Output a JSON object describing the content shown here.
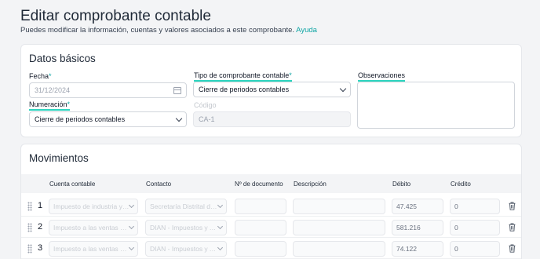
{
  "header": {
    "title": "Editar comprobante contable",
    "subtitle": "Puedes modificar la información, cuentas y valores asociados a este comprobante.",
    "help_link": "Ayuda"
  },
  "basic": {
    "section_title": "Datos básicos",
    "fecha_label": "Fecha",
    "fecha_value": "31/12/2024",
    "tipo_label": "Tipo de comprobante contable",
    "tipo_value": "Cierre de periodos contables",
    "obs_label": "Observaciones",
    "obs_value": "",
    "numeracion_label": "Numeración",
    "numeracion_value": "Cierre de periodos contables",
    "codigo_label": "Código",
    "codigo_value": "CA-1",
    "required_mark": "*"
  },
  "movements": {
    "section_title": "Movimientos",
    "columns": [
      "Cuenta contable",
      "Contacto",
      "Nº de documento",
      "Descripción",
      "Débito",
      "Crédito"
    ],
    "rows": [
      {
        "num": "1",
        "cuenta": "Impuesto de industria y comercio",
        "contacto": "Secretaría Distrital de Hacienda",
        "documento": "",
        "descripcion": "",
        "debito": "47.425",
        "credito": "0"
      },
      {
        "num": "2",
        "cuenta": "Impuesto a las ventas por pagar",
        "contacto": "DIAN - Impuestos y Aduanas",
        "documento": "",
        "descripcion": "",
        "debito": "581.216",
        "credito": "0"
      },
      {
        "num": "3",
        "cuenta": "Impuesto a las ventas por pagar",
        "contacto": "DIAN - Impuestos y Aduanas",
        "documento": "",
        "descripcion": "",
        "debito": "74.122",
        "credito": "0"
      }
    ]
  },
  "colors": {
    "accent": "#0ea5a4",
    "underline": "#2dd4bf"
  },
  "icons": [
    "calendar-icon",
    "chevron-down-icon",
    "drag-handle-icon",
    "trash-icon"
  ]
}
